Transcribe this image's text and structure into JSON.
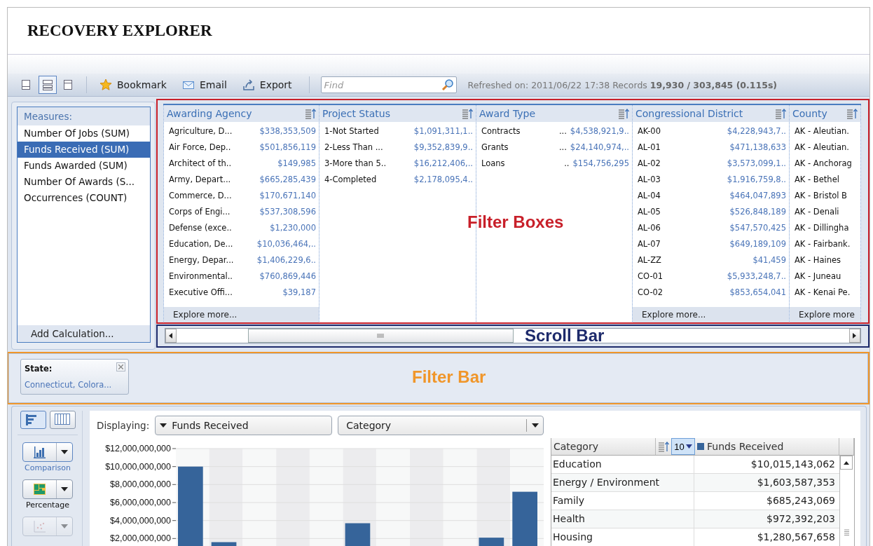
{
  "window": {
    "title": "RECOVERY EXPLORER"
  },
  "toolbar": {
    "layout_buttons": [
      {
        "kind": "bottom",
        "selected": false
      },
      {
        "kind": "stacked",
        "selected": true
      },
      {
        "kind": "top",
        "selected": false
      }
    ],
    "actions": [
      {
        "kind": "bookmark",
        "label": "Bookmark"
      },
      {
        "kind": "email",
        "label": "Email"
      },
      {
        "kind": "export",
        "label": "Export"
      }
    ],
    "search": {
      "placeholder": "Find"
    },
    "status": "Refreshed on: 2011/06/22 17:38 Records **19,930 / 303,845 (0.115s)**"
  },
  "measures": {
    "title": "Measures:",
    "items": [
      {
        "label": "Number Of Jobs (SUM)",
        "selected": false
      },
      {
        "label": "Funds Received (SUM)",
        "selected": true
      },
      {
        "label": "Funds Awarded (SUM)",
        "selected": false
      },
      {
        "label": "Number Of Awards (S...",
        "selected": false
      },
      {
        "label": "Occurrences (COUNT)",
        "selected": false
      }
    ],
    "footer": "Add Calculation..."
  },
  "filter_boxes": [
    {
      "title": "Awarding Agency",
      "footer": "Explore more...",
      "rows": [
        {
          "label": "Agriculture, D...",
          "value": "$338,353,509"
        },
        {
          "label": "Air Force, Dep..",
          "value": "$501,856,119"
        },
        {
          "label": "Architect of th..",
          "value": "$149,985"
        },
        {
          "label": "Army, Depart...",
          "value": "$665,285,439"
        },
        {
          "label": "Commerce, D...",
          "value": "$170,671,140"
        },
        {
          "label": "Corps of Engi...",
          "value": "$537,308,596"
        },
        {
          "label": "Defense (exce..",
          "value": "$1,230,000"
        },
        {
          "label": "Education, De...",
          "value": "$10,036,464,.."
        },
        {
          "label": "Energy, Depar...",
          "value": "$1,406,229,6.."
        },
        {
          "label": "Environmental..",
          "value": "$760,869,446"
        },
        {
          "label": "Executive Offi...",
          "value": "$39,187"
        }
      ]
    },
    {
      "title": "Project Status",
      "rows": [
        {
          "label": "1-Not Started",
          "value": "$1,091,311,1.."
        },
        {
          "label": "2-Less Than ...",
          "value": "$9,352,839,9.."
        },
        {
          "label": "3-More than 5..",
          "value": "$16,212,406,.."
        },
        {
          "label": "4-Completed",
          "value": "$2,178,095,4.."
        }
      ]
    },
    {
      "title": "Award Type",
      "rows": [
        {
          "label": "Contracts",
          "ellipsis": "...",
          "value": "$4,538,921,9.."
        },
        {
          "label": "Grants",
          "ellipsis": "...",
          "value": "$24,140,974,.."
        },
        {
          "label": "Loans",
          "ellipsis": "..",
          "value": "$154,756,295"
        }
      ]
    },
    {
      "title": "Congressional District",
      "footer": "Explore more...",
      "rows": [
        {
          "label": "AK-00",
          "value": "$4,228,943,7.."
        },
        {
          "label": "AL-01",
          "value": "$471,138,633"
        },
        {
          "label": "AL-02",
          "value": "$3,573,099,1.."
        },
        {
          "label": "AL-03",
          "value": "$1,916,759,8.."
        },
        {
          "label": "AL-04",
          "value": "$464,047,893"
        },
        {
          "label": "AL-05",
          "value": "$526,848,189"
        },
        {
          "label": "AL-06",
          "value": "$547,570,425"
        },
        {
          "label": "AL-07",
          "value": "$649,189,109"
        },
        {
          "label": "AL-ZZ",
          "value": "$41,459"
        },
        {
          "label": "CO-01",
          "value": "$5,933,248,7.."
        },
        {
          "label": "CO-02",
          "value": "$853,654,041"
        }
      ]
    },
    {
      "title": "County",
      "footer": "Explore more",
      "rows": [
        {
          "label": "AK - Aleutian."
        },
        {
          "label": "AK - Aleutian."
        },
        {
          "label": "AK - Anchorag"
        },
        {
          "label": "AK - Bethel"
        },
        {
          "label": "AK - Bristol B"
        },
        {
          "label": "AK - Denali"
        },
        {
          "label": "AK - Dillingha"
        },
        {
          "label": "AK - Fairbank."
        },
        {
          "label": "AK - Haines"
        },
        {
          "label": "AK - Juneau"
        },
        {
          "label": "AK - Kenai Pe."
        }
      ]
    }
  ],
  "filter_bar": {
    "chips": [
      {
        "label": "State:",
        "value": "Connecticut, Colora..."
      }
    ]
  },
  "view": {
    "view_buttons": [
      {
        "kind": "chart",
        "selected": true
      },
      {
        "kind": "grid",
        "selected": false
      }
    ],
    "chart_types": [
      {
        "kind": "bar",
        "label": "Comparison",
        "disabled": false,
        "selected": true
      },
      {
        "kind": "treemap",
        "label": "Percentage",
        "disabled": false,
        "selected": false
      },
      {
        "kind": "scatter",
        "disabled": true,
        "selected": false
      }
    ],
    "displaying_label": "Displaying:",
    "measure_dropdown": "Funds Received",
    "dimension_dropdown": "Category",
    "chart_data": {
      "type": "bar",
      "grid": true,
      "ylim": [
        0,
        12000000000
      ],
      "yticks": [
        {
          "value": 2000000000,
          "label": "$2,000,000,000"
        },
        {
          "value": 4000000000,
          "label": "$4,000,000,000"
        },
        {
          "value": 6000000000,
          "label": "$6,000,000,000"
        },
        {
          "value": 8000000000,
          "label": "$8,000,000,000"
        },
        {
          "value": 10000000000,
          "label": "$10,000,000,000"
        },
        {
          "value": 12000000000,
          "label": "$12,000,000,000"
        }
      ],
      "series": [
        {
          "name": "Funds Received",
          "color": "#36649a",
          "values": [
            10000000000,
            1600000000,
            null,
            null,
            null,
            3700000000,
            null,
            null,
            null,
            2100000000,
            7200000000
          ]
        }
      ]
    },
    "table": {
      "columns": [
        "Category"
      ],
      "top_n": "10",
      "rows": [
        [
          "Education",
          "$10,015,143,062"
        ],
        [
          "Energy / Environment",
          "$1,603,587,353"
        ],
        [
          "Family",
          "$685,243,069"
        ],
        [
          "Health",
          "$972,392,203"
        ],
        [
          "Housing",
          "$1,280,567,658"
        ]
      ]
    }
  },
  "annotations": [
    {
      "kind": "filter_boxes",
      "label": "Filter Boxes",
      "color": "#c8202a"
    },
    {
      "kind": "scroll_bar",
      "label": "Scroll Bar",
      "color": "#1d2a6b"
    },
    {
      "kind": "filter_bar",
      "label": "Filter Bar",
      "color": "#f0962a"
    }
  ]
}
